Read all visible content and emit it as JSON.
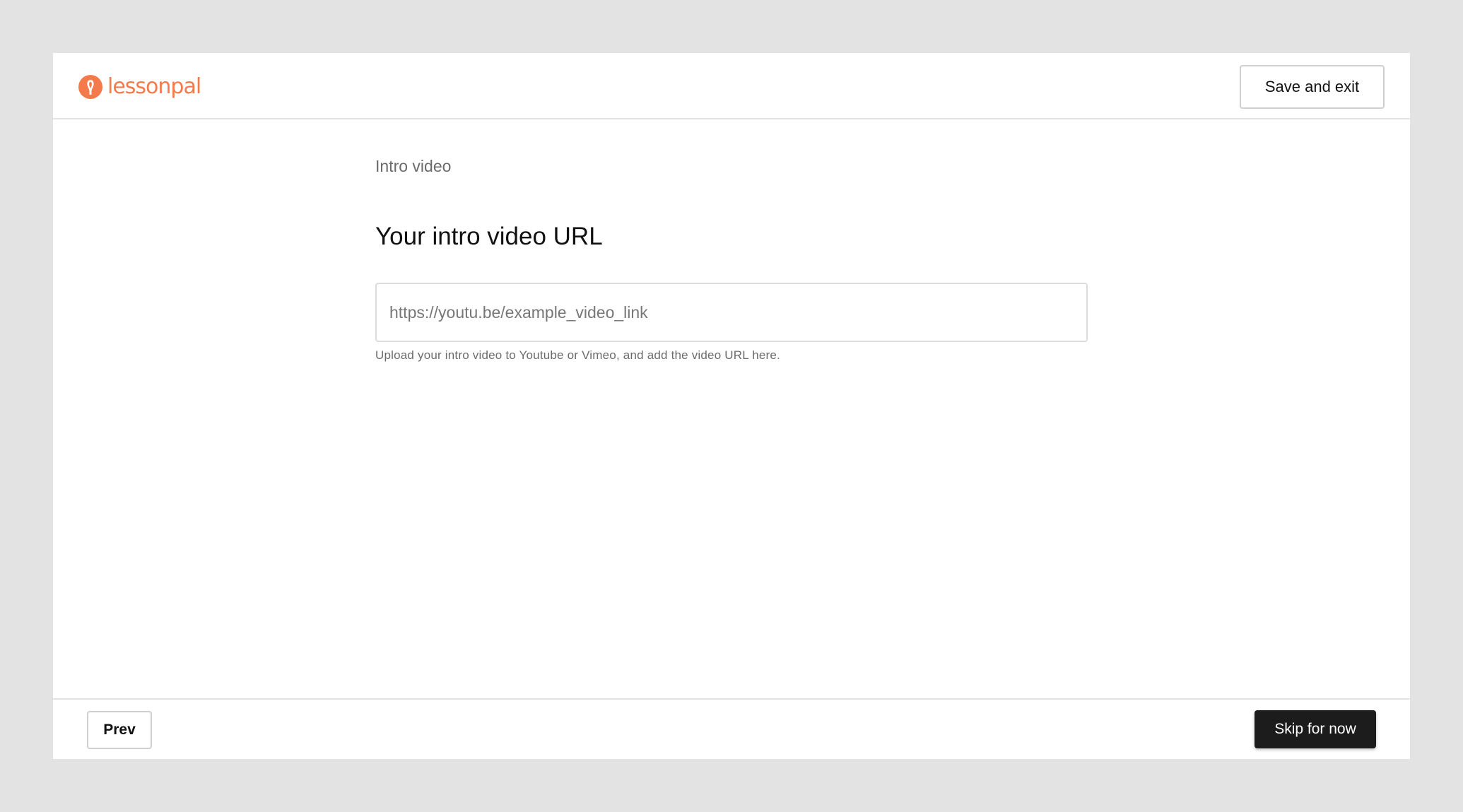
{
  "brand": {
    "name": "lessonpal",
    "color": "#f57a4b",
    "logo_icon": "lessonpal-logo-icon"
  },
  "header": {
    "save_exit_label": "Save and exit"
  },
  "main": {
    "step_label": "Intro video",
    "title": "Your intro video URL",
    "url_input": {
      "value": "",
      "placeholder": "https://youtu.be/example_video_link"
    },
    "helper_text": "Upload your intro video to Youtube or Vimeo, and add the video URL here."
  },
  "footer": {
    "prev_label": "Prev",
    "skip_label": "Skip for now"
  },
  "colors": {
    "background": "#e3e3e3",
    "surface": "#ffffff",
    "primary_button": "#1c1c1c",
    "border": "#dcdcdc"
  }
}
